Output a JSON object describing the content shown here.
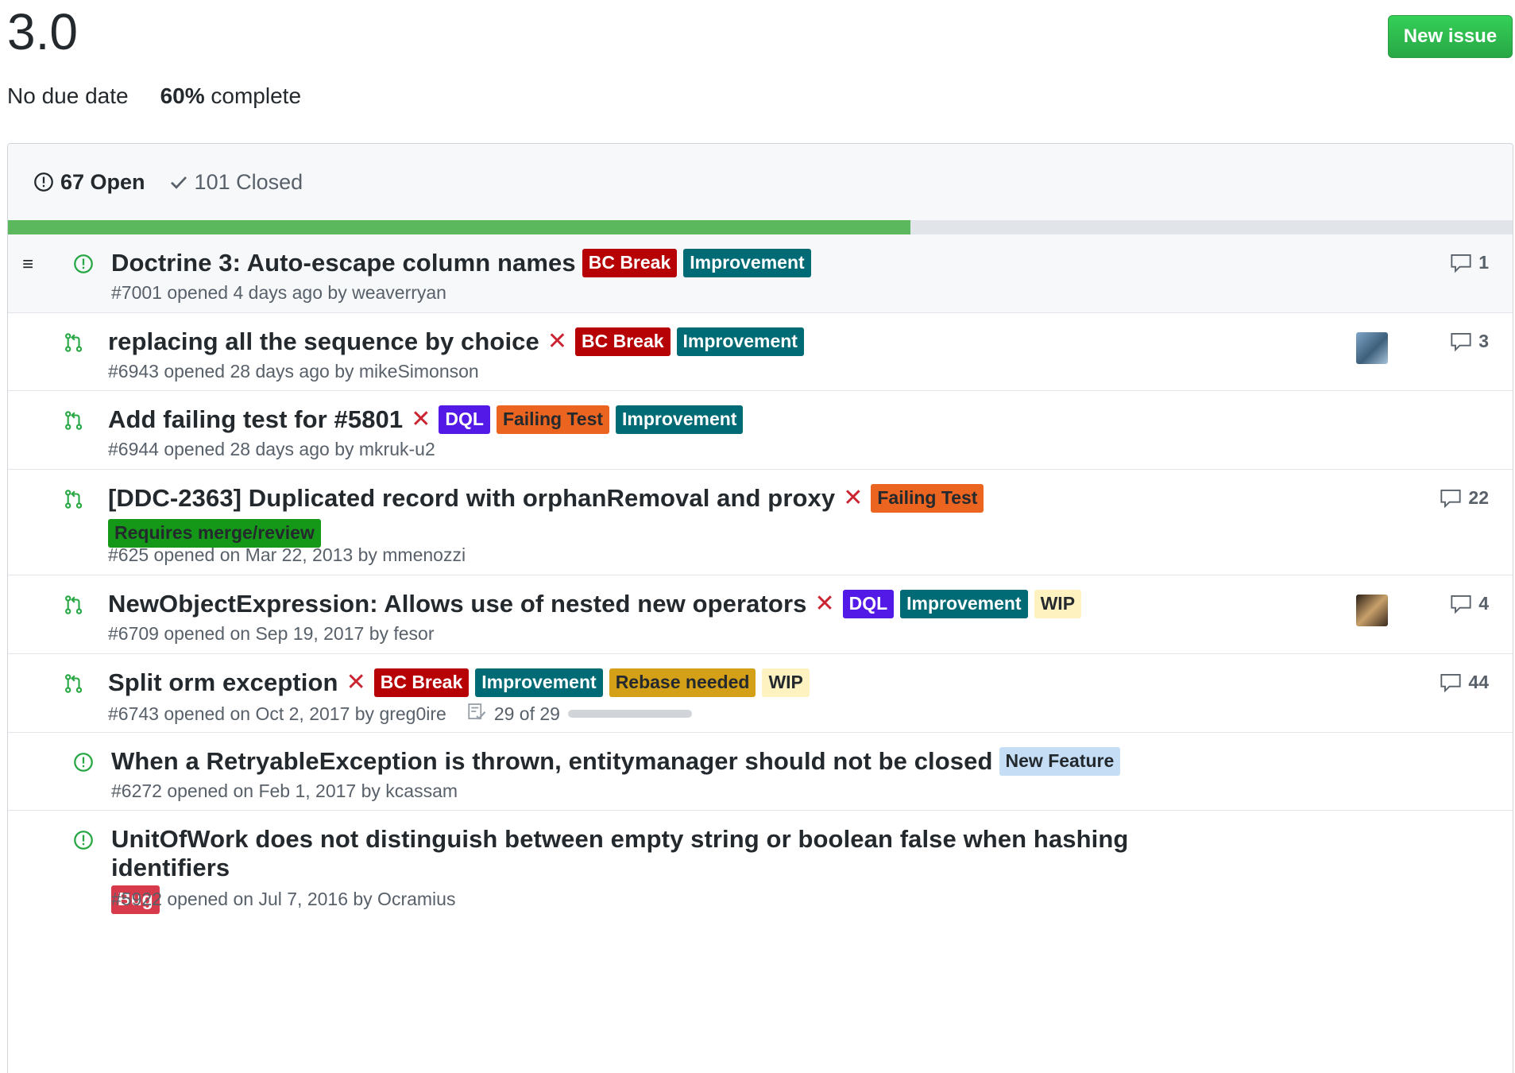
{
  "milestone": {
    "title": "3.0",
    "due": "No due date",
    "percent": "60%",
    "complete_word": "complete",
    "progress_fraction": 0.6
  },
  "new_issue_label": "New issue",
  "states": {
    "open": "67 Open",
    "closed": "101 Closed"
  },
  "colors": {
    "open_green": "#28a745",
    "failure_red": "#cb2431",
    "progress": "#5cb85c"
  },
  "issues": [
    {
      "type": "issue",
      "title": "Doctrine 3: Auto-escape column names",
      "status_x": "",
      "labels": [
        {
          "text": "BC Break",
          "bg": "#b60205",
          "fg": "#ffffff"
        },
        {
          "text": "Improvement",
          "bg": "#006b75",
          "fg": "#ffffff"
        }
      ],
      "meta": "#7001 opened 4 days ago by weaverryan",
      "comments": "1",
      "avatar": "",
      "tasks": ""
    },
    {
      "type": "pr",
      "title": "replacing all the sequence by choice",
      "status_x": "✕",
      "labels": [
        {
          "text": "BC Break",
          "bg": "#b60205",
          "fg": "#ffffff"
        },
        {
          "text": "Improvement",
          "bg": "#006b75",
          "fg": "#ffffff"
        }
      ],
      "meta": "#6943 opened 28 days ago by mikeSimonson",
      "comments": "3",
      "avatar": "avatar-mikesimonson",
      "tasks": ""
    },
    {
      "type": "pr",
      "title": "Add failing test for #5801",
      "status_x": "✕",
      "labels": [
        {
          "text": "DQL",
          "bg": "#5319e7",
          "fg": "#ffffff"
        },
        {
          "text": "Failing Test",
          "bg": "#eb6420",
          "fg": "#24292e"
        },
        {
          "text": "Improvement",
          "bg": "#006b75",
          "fg": "#ffffff"
        }
      ],
      "meta": "#6944 opened 28 days ago by mkruk-u2",
      "comments": "",
      "avatar": "",
      "tasks": ""
    },
    {
      "type": "pr",
      "title": "[DDC-2363] Duplicated record with orphanRemoval and proxy",
      "status_x": "✕",
      "labels": [
        {
          "text": "Failing Test",
          "bg": "#eb6420",
          "fg": "#24292e"
        },
        {
          "text": "Requires merge/review",
          "bg": "#159818",
          "fg": "#24292e"
        }
      ],
      "meta": "#625 opened on Mar 22, 2013 by mmenozzi",
      "comments": "22",
      "avatar": "",
      "tasks": ""
    },
    {
      "type": "pr",
      "title": "NewObjectExpression: Allows use of nested new operators",
      "status_x": "✕",
      "labels": [
        {
          "text": "DQL",
          "bg": "#5319e7",
          "fg": "#ffffff"
        },
        {
          "text": "Improvement",
          "bg": "#006b75",
          "fg": "#ffffff"
        },
        {
          "text": "WIP",
          "bg": "#fef2c0",
          "fg": "#24292e"
        }
      ],
      "meta": "#6709 opened on Sep 19, 2017 by fesor",
      "comments": "4",
      "avatar": "avatar-fesor",
      "tasks": ""
    },
    {
      "type": "pr",
      "title": "Split orm exception",
      "status_x": "✕",
      "labels": [
        {
          "text": "BC Break",
          "bg": "#b60205",
          "fg": "#ffffff"
        },
        {
          "text": "Improvement",
          "bg": "#006b75",
          "fg": "#ffffff"
        },
        {
          "text": "Rebase needed",
          "bg": "#d4a017",
          "fg": "#24292e"
        },
        {
          "text": "WIP",
          "bg": "#fef2c0",
          "fg": "#24292e"
        }
      ],
      "meta": "#6743 opened on Oct 2, 2017 by greg0ire",
      "comments": "44",
      "avatar": "",
      "tasks": "29 of 29"
    },
    {
      "type": "issue",
      "title": "When a RetryableException is thrown, entitymanager should not be closed",
      "status_x": "",
      "labels": [
        {
          "text": "New Feature",
          "bg": "#c5def5",
          "fg": "#24292e"
        }
      ],
      "meta": "#6272 opened on Feb 1, 2017 by kcassam",
      "comments": "",
      "avatar": "",
      "tasks": ""
    },
    {
      "type": "issue",
      "title": "UnitOfWork does not distinguish between empty string or boolean false when hashing identifiers",
      "status_x": "",
      "labels": [
        {
          "text": "Bug",
          "bg": "#d73a4a",
          "fg": "#ffffff"
        }
      ],
      "meta": "#5922 opened on Jul 7, 2016 by Ocramius",
      "comments": "",
      "avatar": "",
      "tasks": ""
    }
  ]
}
